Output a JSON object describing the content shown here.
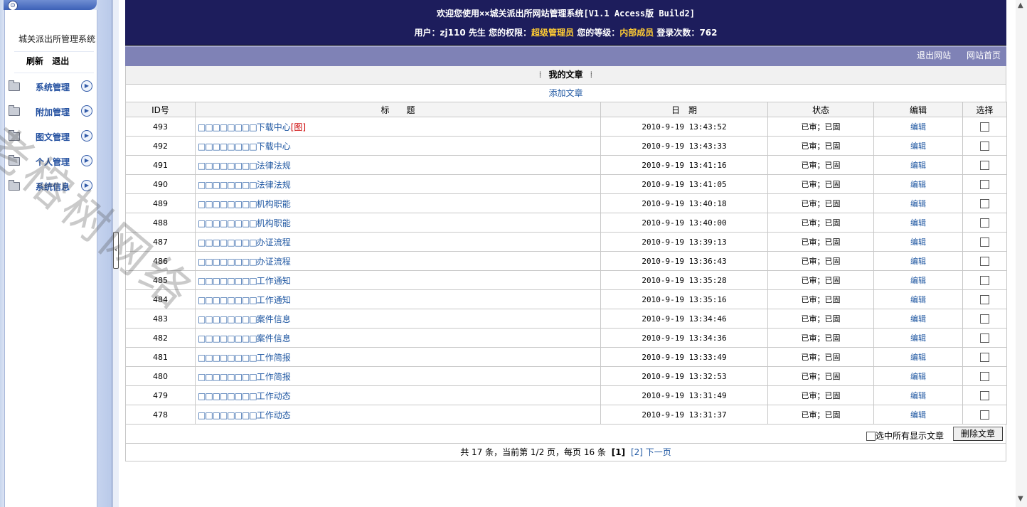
{
  "left": {
    "system_title": "城关派出所管理系统",
    "refresh": "刷新",
    "logout": "退出",
    "menu": [
      {
        "label": "系统管理"
      },
      {
        "label": "附加管理"
      },
      {
        "label": "图文管理"
      },
      {
        "label": "个人管理"
      },
      {
        "label": "系统信息"
      }
    ]
  },
  "header": {
    "welcome": "欢迎您使用××城关派出所网站管理系统[V1.1 Access版 Build2]",
    "user_prefix": "用户：",
    "user": "zj110",
    "user_suffix": " 先生  您的权限：",
    "role": "超级管理员",
    "level_prefix": "  您的等级：",
    "level": "内部成员",
    "login_prefix": "  登录次数：",
    "login_count": "762"
  },
  "nav": {
    "exit_site": "退出网站",
    "home": "网站首页"
  },
  "section": {
    "title": "我的文章",
    "add_article": "添加文章"
  },
  "table": {
    "headers": {
      "id": "ID号",
      "title": "标　　题",
      "date": "日　期",
      "status": "状态",
      "edit": "编辑",
      "select": "选择"
    },
    "rows": [
      {
        "id": "493",
        "title": "下载中心",
        "pic": "[图]",
        "date": "2010-9-19 13:43:52",
        "status": "已审；已固",
        "edit": "编辑"
      },
      {
        "id": "492",
        "title": "下载中心",
        "pic": "",
        "date": "2010-9-19 13:43:33",
        "status": "已审；已固",
        "edit": "编辑"
      },
      {
        "id": "491",
        "title": "法律法规",
        "pic": "",
        "date": "2010-9-19 13:41:16",
        "status": "已审；已固",
        "edit": "编辑"
      },
      {
        "id": "490",
        "title": "法律法规",
        "pic": "",
        "date": "2010-9-19 13:41:05",
        "status": "已审；已固",
        "edit": "编辑"
      },
      {
        "id": "489",
        "title": "机构职能",
        "pic": "",
        "date": "2010-9-19 13:40:18",
        "status": "已审；已固",
        "edit": "编辑"
      },
      {
        "id": "488",
        "title": "机构职能",
        "pic": "",
        "date": "2010-9-19 13:40:00",
        "status": "已审；已固",
        "edit": "编辑"
      },
      {
        "id": "487",
        "title": "办证流程",
        "pic": "",
        "date": "2010-9-19 13:39:13",
        "status": "已审；已固",
        "edit": "编辑"
      },
      {
        "id": "486",
        "title": "办证流程",
        "pic": "",
        "date": "2010-9-19 13:36:43",
        "status": "已审；已固",
        "edit": "编辑"
      },
      {
        "id": "485",
        "title": "工作通知",
        "pic": "",
        "date": "2010-9-19 13:35:28",
        "status": "已审；已固",
        "edit": "编辑"
      },
      {
        "id": "484",
        "title": "工作通知",
        "pic": "",
        "date": "2010-9-19 13:35:16",
        "status": "已审；已固",
        "edit": "编辑"
      },
      {
        "id": "483",
        "title": "案件信息",
        "pic": "",
        "date": "2010-9-19 13:34:46",
        "status": "已审；已固",
        "edit": "编辑"
      },
      {
        "id": "482",
        "title": "案件信息",
        "pic": "",
        "date": "2010-9-19 13:34:36",
        "status": "已审；已固",
        "edit": "编辑"
      },
      {
        "id": "481",
        "title": "工作简报",
        "pic": "",
        "date": "2010-9-19 13:33:49",
        "status": "已审；已固",
        "edit": "编辑"
      },
      {
        "id": "480",
        "title": "工作简报",
        "pic": "",
        "date": "2010-9-19 13:32:53",
        "status": "已审；已固",
        "edit": "编辑"
      },
      {
        "id": "479",
        "title": "工作动态",
        "pic": "",
        "date": "2010-9-19 13:31:49",
        "status": "已审；已固",
        "edit": "编辑"
      },
      {
        "id": "478",
        "title": "工作动态",
        "pic": "",
        "date": "2010-9-19 13:31:37",
        "status": "已审；已固",
        "edit": "编辑"
      }
    ],
    "title_prefix_glyphs": "□□□□□□□□"
  },
  "footer": {
    "select_all": "选中所有显示文章",
    "delete_button": "删除文章",
    "pager_text": "共 17 条，当前第 1/2 页，每页 16 条",
    "current_page": "[1]",
    "page2": "[2]",
    "next": "下一页"
  },
  "watermark": "老榕树网络"
}
